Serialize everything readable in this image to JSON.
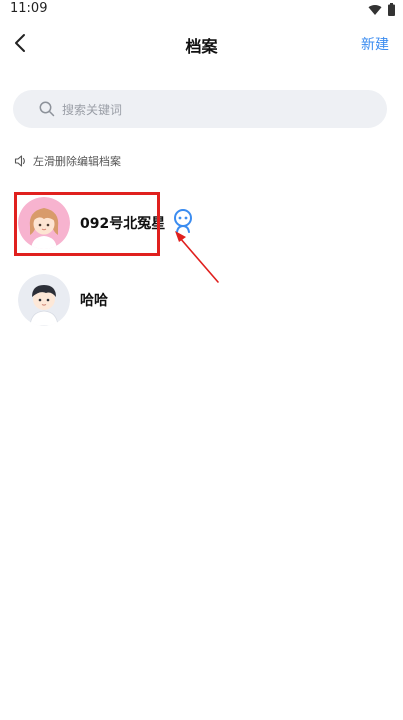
{
  "status_bar": {
    "time": "11:09"
  },
  "nav": {
    "title": "档案",
    "new_label": "新建"
  },
  "search": {
    "placeholder": "搜索关键词",
    "value": ""
  },
  "hint": {
    "text": "左滑删除编辑档案"
  },
  "profiles": [
    {
      "name": "092号北冤星",
      "avatar": "girl-avatar"
    },
    {
      "name": "哈哈",
      "avatar": "boy-avatar"
    }
  ],
  "colors": {
    "accent": "#3b8cf0",
    "highlight": "#e0201e",
    "search_bg": "#eef0f4"
  }
}
